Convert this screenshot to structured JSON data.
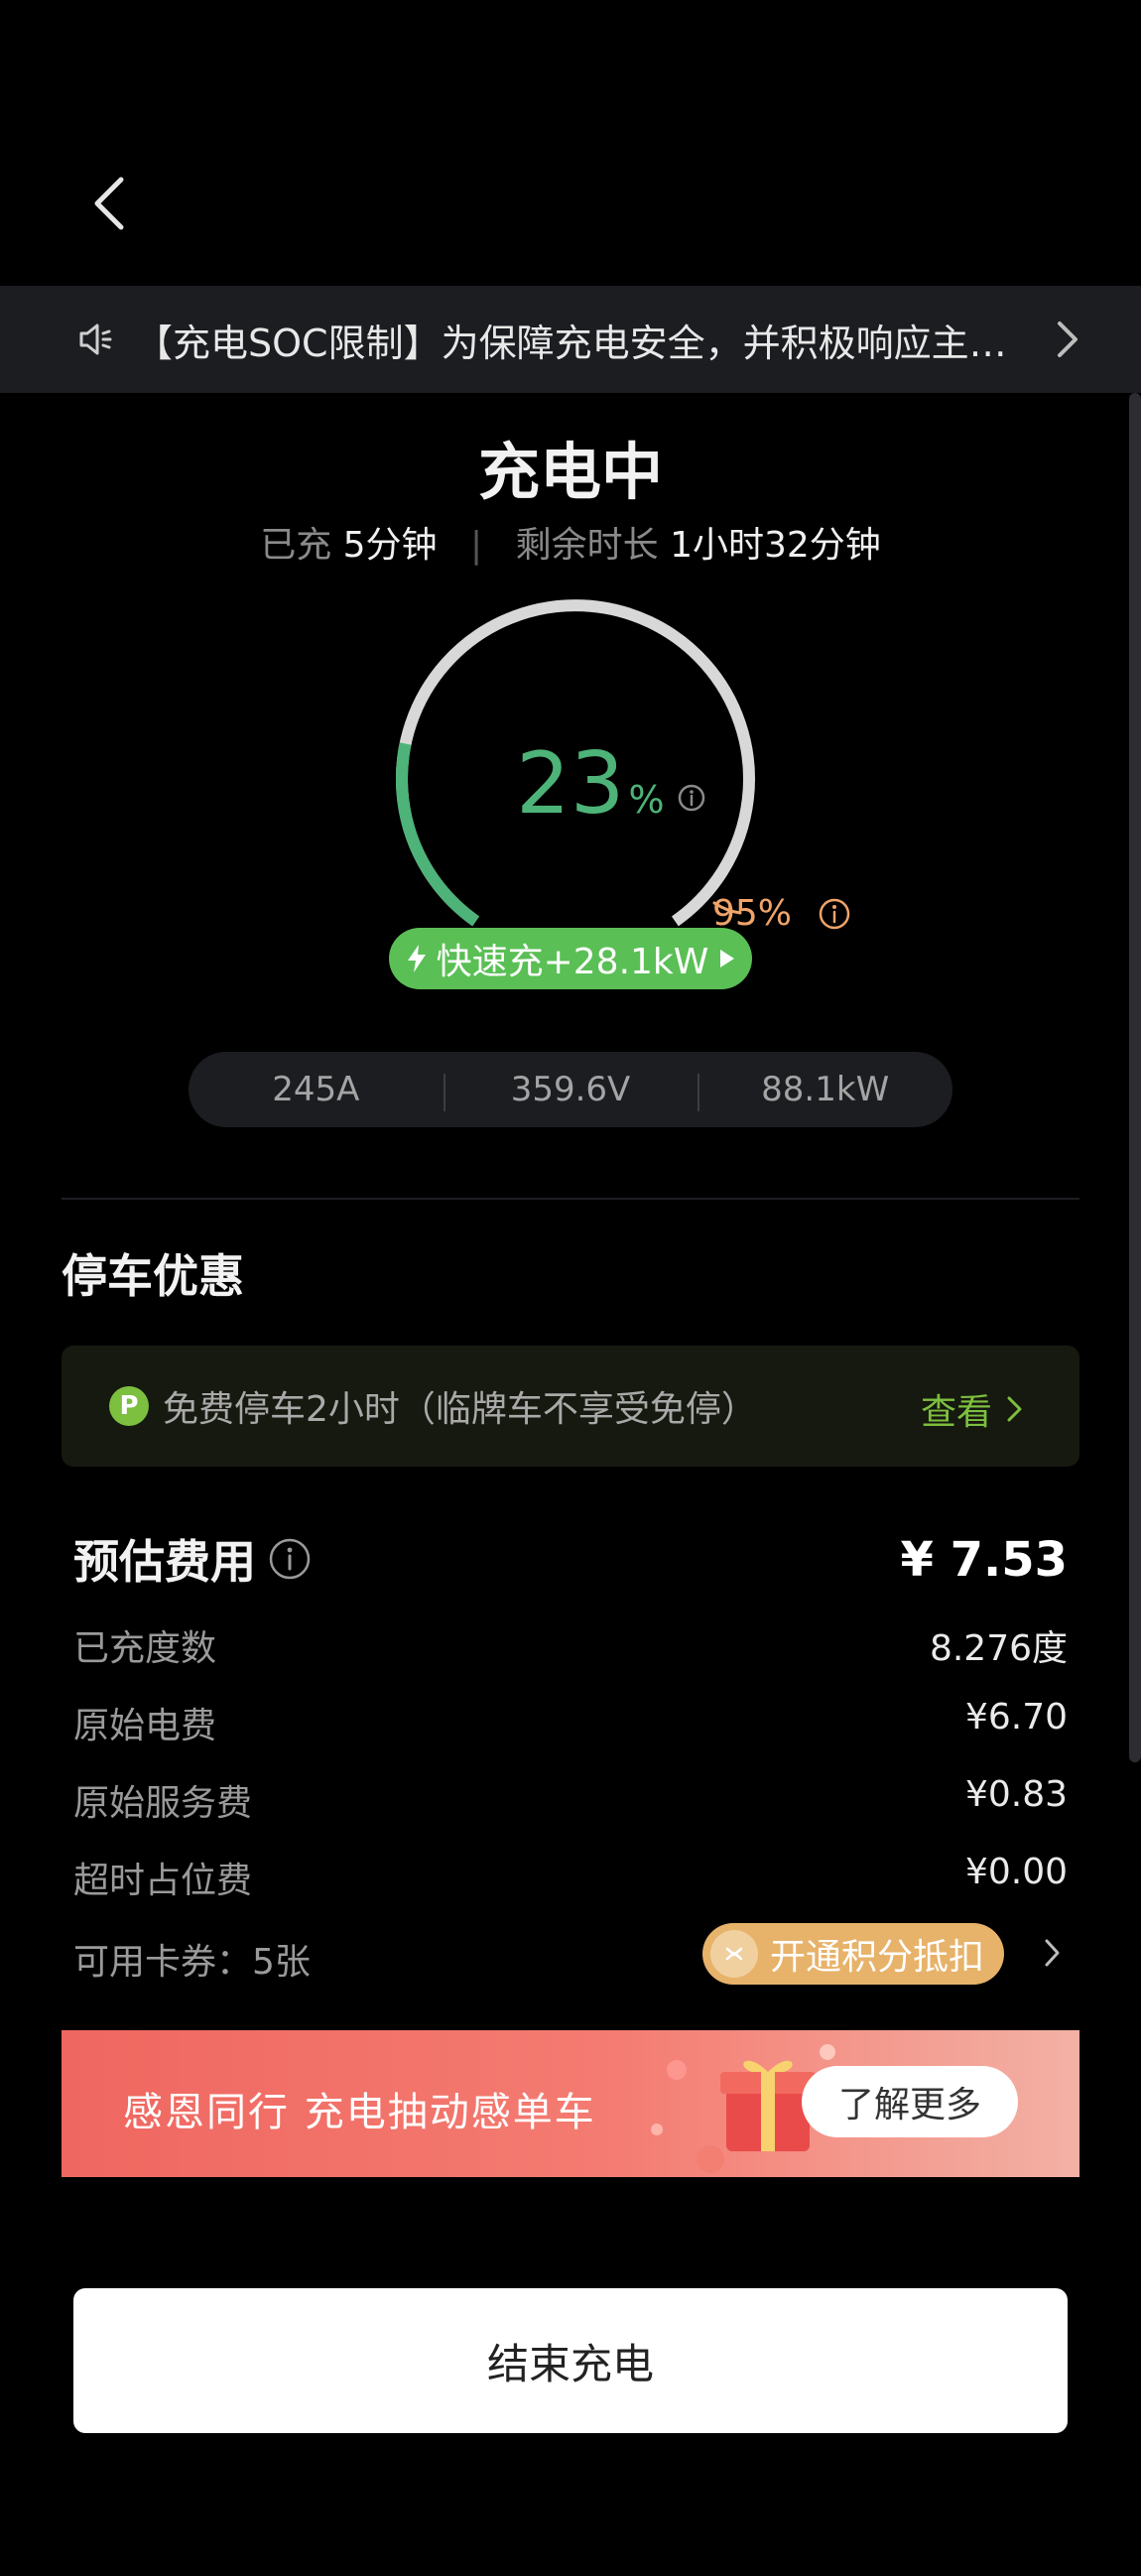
{
  "notice": {
    "text": "【充电SOC限制】为保障充电安全，并积极响应主管..."
  },
  "status": {
    "title": "充电中",
    "charged_label": "已充",
    "charged_value": "5分钟",
    "remaining_label": "剩余时长",
    "remaining_value": "1小时32分钟"
  },
  "gauge": {
    "percent_value": "23",
    "percent_sign": "%",
    "level_fraction": 0.23,
    "limit_label": "95%",
    "colors": {
      "progress": "#4db378",
      "track": "#d8d8d8",
      "limit": "#f0a46a"
    }
  },
  "fast_charge": {
    "label": "快速充+28.1kW"
  },
  "metrics": {
    "current": "245A",
    "voltage": "359.6V",
    "power": "88.1kW"
  },
  "parking": {
    "title": "停车优惠",
    "p_badge": "P",
    "text": "免费停车2小时（临牌车不享受免停）",
    "link": "查看"
  },
  "fees": {
    "title": "预估费用",
    "total": "¥ 7.53",
    "rows": [
      {
        "label": "已充度数",
        "value": "8.276度"
      },
      {
        "label": "原始电费",
        "value": "¥6.70"
      },
      {
        "label": "原始服务费",
        "value": "¥0.83"
      },
      {
        "label": "超时占位费",
        "value": "¥0.00"
      }
    ],
    "coupon_label": "可用卡券：5张",
    "points_button": "开通积分抵扣"
  },
  "banner": {
    "text": "感恩同行 充电抽动感单车",
    "button": "了解更多"
  },
  "end_button": "结束充电"
}
